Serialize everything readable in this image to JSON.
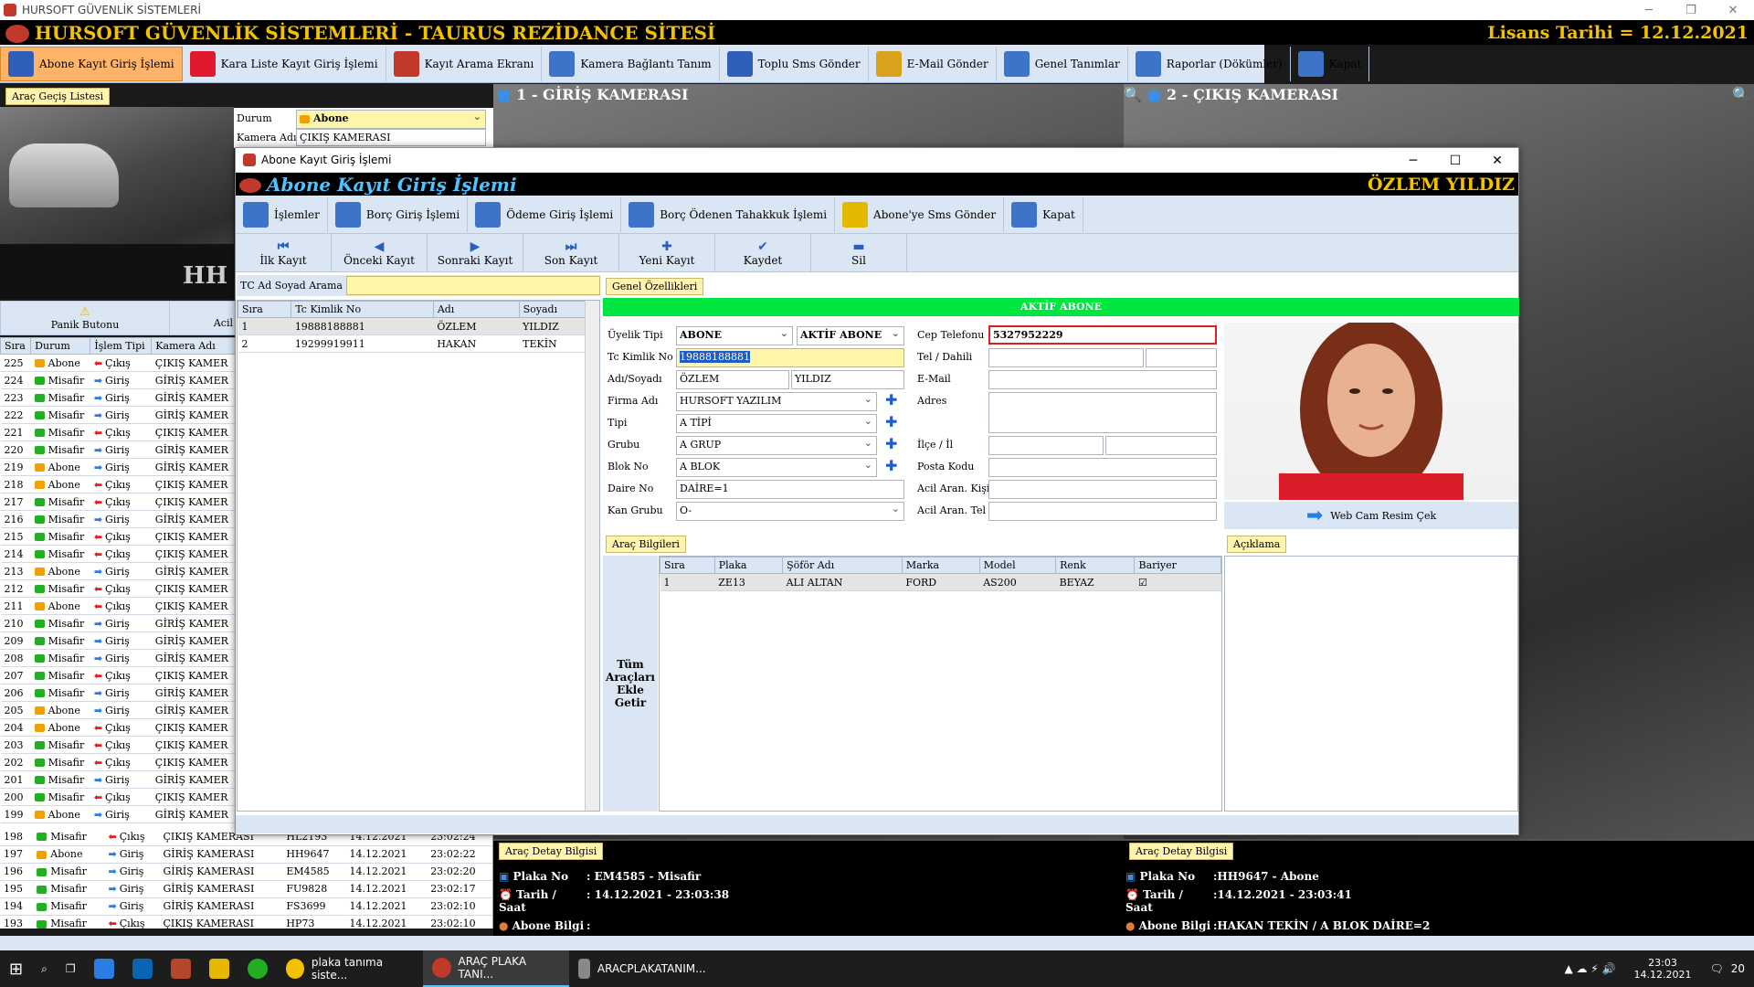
{
  "window": {
    "title": "HURSOFT GÜVENLİK SİSTEMLERİ"
  },
  "banner": {
    "title": "HURSOFT GÜVENLİK SİSTEMLERİ - TAURUS REZİDANCE SİTESİ",
    "license": "Lisans Tarihi = 12.12.2021"
  },
  "toolbar": {
    "items": [
      {
        "label": "Abone Kayıt Giriş İşlemi",
        "icon": "grid-icon",
        "color": "#2f5fb8"
      },
      {
        "label": "Kara Liste Kayıt Giriş İşlemi",
        "icon": "close-circle-icon",
        "color": "#e0192f"
      },
      {
        "label": "Kayıt Arama Ekranı",
        "icon": "search-tool-icon",
        "color": "#c0392b"
      },
      {
        "label": "Kamera Bağlantı Tanım",
        "icon": "document-arrow-icon",
        "color": "#3d74c9"
      },
      {
        "label": "Toplu Sms Gönder",
        "icon": "info-icon",
        "color": "#2f5fb8"
      },
      {
        "label": "E-Mail Gönder",
        "icon": "keyboard-icon",
        "color": "#d8a21c"
      },
      {
        "label": "Genel Tanımlar",
        "icon": "calendar-icon",
        "color": "#3d74c9"
      },
      {
        "label": "Raporlar (Dökümler)",
        "icon": "report-search-icon",
        "color": "#3d74c9"
      },
      {
        "label": "Kapat",
        "icon": "exit-icon",
        "color": "#3d74c9"
      }
    ]
  },
  "left": {
    "tab": "Araç Geçiş Listesi",
    "status_label": "Durum",
    "status_value": "Abone",
    "camera_label": "Kamera Adı",
    "camera_value": "ÇIKIŞ KAMERASI",
    "panic_label": "Panik Butonu",
    "acil_label": "Acil",
    "columns": [
      "Sıra",
      "Durum",
      "İşlem Tipi",
      "Kamera Adı"
    ],
    "rows": [
      {
        "no": "225",
        "status": "Abone",
        "type": "Çıkış",
        "camera": "ÇIKIŞ KAMER"
      },
      {
        "no": "224",
        "status": "Misafir",
        "type": "Giriş",
        "camera": "GİRİŞ KAMER"
      },
      {
        "no": "223",
        "status": "Misafir",
        "type": "Giriş",
        "camera": "GİRİŞ KAMER"
      },
      {
        "no": "222",
        "status": "Misafir",
        "type": "Giriş",
        "camera": "GİRİŞ KAMER"
      },
      {
        "no": "221",
        "status": "Misafir",
        "type": "Çıkış",
        "camera": "ÇIKIŞ KAMER"
      },
      {
        "no": "220",
        "status": "Misafir",
        "type": "Giriş",
        "camera": "GİRİŞ KAMER"
      },
      {
        "no": "219",
        "status": "Abone",
        "type": "Giriş",
        "camera": "GİRİŞ KAMER"
      },
      {
        "no": "218",
        "status": "Abone",
        "type": "Çıkış",
        "camera": "ÇIKIŞ KAMER"
      },
      {
        "no": "217",
        "status": "Misafir",
        "type": "Çıkış",
        "camera": "ÇIKIŞ KAMER"
      },
      {
        "no": "216",
        "status": "Misafir",
        "type": "Giriş",
        "camera": "GİRİŞ KAMER"
      },
      {
        "no": "215",
        "status": "Misafir",
        "type": "Çıkış",
        "camera": "ÇIKIŞ KAMER"
      },
      {
        "no": "214",
        "status": "Misafir",
        "type": "Çıkış",
        "camera": "ÇIKIŞ KAMER"
      },
      {
        "no": "213",
        "status": "Abone",
        "type": "Giriş",
        "camera": "GİRİŞ KAMER"
      },
      {
        "no": "212",
        "status": "Misafir",
        "type": "Çıkış",
        "camera": "ÇIKIŞ KAMER"
      },
      {
        "no": "211",
        "status": "Abone",
        "type": "Çıkış",
        "camera": "ÇIKIŞ KAMER"
      },
      {
        "no": "210",
        "status": "Misafir",
        "type": "Giriş",
        "camera": "GİRİŞ KAMER"
      },
      {
        "no": "209",
        "status": "Misafir",
        "type": "Giriş",
        "camera": "GİRİŞ KAMER"
      },
      {
        "no": "208",
        "status": "Misafir",
        "type": "Giriş",
        "camera": "GİRİŞ KAMER"
      },
      {
        "no": "207",
        "status": "Misafir",
        "type": "Çıkış",
        "camera": "ÇIKIŞ KAMER"
      },
      {
        "no": "206",
        "status": "Misafir",
        "type": "Giriş",
        "camera": "GİRİŞ KAMER"
      },
      {
        "no": "205",
        "status": "Abone",
        "type": "Giriş",
        "camera": "GİRİŞ KAMER"
      },
      {
        "no": "204",
        "status": "Abone",
        "type": "Çıkış",
        "camera": "ÇIKIŞ KAMER"
      },
      {
        "no": "203",
        "status": "Misafir",
        "type": "Çıkış",
        "camera": "ÇIKIŞ KAMER"
      },
      {
        "no": "202",
        "status": "Misafir",
        "type": "Çıkış",
        "camera": "ÇIKIŞ KAMER"
      },
      {
        "no": "201",
        "status": "Misafir",
        "type": "Giriş",
        "camera": "GİRİŞ KAMER"
      },
      {
        "no": "200",
        "status": "Misafir",
        "type": "Çıkış",
        "camera": "ÇIKIŞ KAMER"
      },
      {
        "no": "199",
        "status": "Abone",
        "type": "Giriş",
        "camera": "GİRİŞ KAMER"
      }
    ],
    "rows_full": [
      {
        "no": "198",
        "status": "Misafir",
        "type": "Çıkış",
        "camera": "ÇIKIŞ KAMERASI",
        "plate": "HL2193",
        "date": "14.12.2021",
        "time": "23:02:24"
      },
      {
        "no": "197",
        "status": "Abone",
        "type": "Giriş",
        "camera": "GİRİŞ KAMERASI",
        "plate": "HH9647",
        "date": "14.12.2021",
        "time": "23:02:22"
      },
      {
        "no": "196",
        "status": "Misafir",
        "type": "Giriş",
        "camera": "GİRİŞ KAMERASI",
        "plate": "EM4585",
        "date": "14.12.2021",
        "time": "23:02:20"
      },
      {
        "no": "195",
        "status": "Misafir",
        "type": "Giriş",
        "camera": "GİRİŞ KAMERASI",
        "plate": "FU9828",
        "date": "14.12.2021",
        "time": "23:02:17"
      },
      {
        "no": "194",
        "status": "Misafir",
        "type": "Giriş",
        "camera": "GİRİŞ KAMERASI",
        "plate": "FS3699",
        "date": "14.12.2021",
        "time": "23:02:10"
      },
      {
        "no": "193",
        "status": "Misafir",
        "type": "Çıkış",
        "camera": "ÇIKIŞ KAMERASI",
        "plate": "HP73",
        "date": "14.12.2021",
        "time": "23:02:10"
      }
    ]
  },
  "cameras": {
    "cam1": "1 - GİRİŞ KAMERASI",
    "cam2": "2 - ÇIKIŞ KAMERASI"
  },
  "details": {
    "tab": "Araç Detay Bilgisi",
    "plate_label": "Plaka No",
    "datetime_label": "Tarih / Saat",
    "owner_label": "Abone Bilgi",
    "left": {
      "plate": ": EM4585 - Misafir",
      "datetime": ": 14.12.2021 - 23:03:38",
      "owner": ":"
    },
    "right": {
      "plate": ":HH9647 - Abone",
      "datetime": ":14.12.2021 - 23:03:41",
      "owner": ":HAKAN TEKİN / A BLOK DAİRE=2"
    }
  },
  "dialog": {
    "title": "Abone Kayıt Giriş İşlemi",
    "banner_title": "Abone Kayıt Giriş İşlemi",
    "banner_name": "ÖZLEM YILDIZ",
    "tools": [
      {
        "label": "İşlemler",
        "icon": "operations-icon",
        "color": "#3d74c9"
      },
      {
        "label": "Borç Giriş İşlemi",
        "icon": "debt-entry-icon",
        "color": "#3d74c9"
      },
      {
        "label": "Ödeme Giriş İşlemi",
        "icon": "payment-icon",
        "color": "#3d74c9"
      },
      {
        "label": "Borç Ödenen Tahakkuk İşlemi",
        "icon": "accrual-icon",
        "color": "#3d74c9"
      },
      {
        "label": "Abone'ye Sms Gönder",
        "icon": "warning-icon",
        "color": "#e5b800"
      },
      {
        "label": "Kapat",
        "icon": "exit-icon",
        "color": "#3d74c9"
      }
    ],
    "nav": [
      {
        "label": "İlk Kayıt",
        "glyph": "⏮"
      },
      {
        "label": "Önceki Kayıt",
        "glyph": "◀"
      },
      {
        "label": "Sonraki Kayıt",
        "glyph": "▶"
      },
      {
        "label": "Son Kayıt",
        "glyph": "⏭"
      },
      {
        "label": "Yeni Kayıt",
        "glyph": "✚"
      },
      {
        "label": "Kaydet",
        "glyph": "✔"
      },
      {
        "label": "Sil",
        "glyph": "▬"
      }
    ],
    "search_label": "TC Ad Soyad Arama",
    "search_value": "",
    "list_columns": [
      "Sıra",
      "Tc Kimlik No",
      "Adı",
      "Soyadı"
    ],
    "list_rows": [
      {
        "no": "1",
        "tc": "19888188881",
        "name": "ÖZLEM",
        "surname": "YILDIZ"
      },
      {
        "no": "2",
        "tc": "19299919911",
        "name": "HAKAN",
        "surname": "TEKİN"
      }
    ],
    "general_tab": "Genel Özellikleri",
    "active_status": "AKTİF ABONE",
    "form": {
      "uyelik_label": "Üyelik Tipi",
      "uyelik_value": "ABONE",
      "uyelik_status": "AKTİF ABONE",
      "tc_label": "Tc Kimlik No",
      "tc_value": "19888188881",
      "adsoyad_label": "Adı/Soyadı",
      "ad_value": "ÖZLEM",
      "soyad_value": "YILDIZ",
      "firma_label": "Firma Adı",
      "firma_value": "HURSOFT YAZILIM",
      "tipi_label": "Tipi",
      "tipi_value": "A TİPİ",
      "grubu_label": "Grubu",
      "grubu_value": "A GRUP",
      "blok_label": "Blok No",
      "blok_value": "A BLOK",
      "daire_label": "Daire No",
      "daire_value": "DAİRE=1",
      "kan_label": "Kan Grubu",
      "kan_value": "O-",
      "cep_label": "Cep Telefonu",
      "cep_value": "5327952229",
      "tel_label": "Tel / Dahili",
      "tel_value": "",
      "dahili_value": "",
      "email_label": "E-Mail",
      "email_value": "",
      "adres_label": "Adres",
      "adres_value": "",
      "ilce_label": "İlçe / İl",
      "ilce_value": "",
      "il_value": "",
      "posta_label": "Posta Kodu",
      "posta_value": "",
      "acil_kisi_label": "Acil Aran. Kişi",
      "acil_kisi_value": "",
      "acil_tel_label": "Acil Aran. Tel",
      "acil_tel_value": ""
    },
    "webcam_label": "Web Cam Resim Çek",
    "vehicle_tab": "Araç Bilgileri",
    "add_all_label": "Tüm Araçları Ekle Getir",
    "vehicle_columns": [
      "Sıra",
      "Plaka",
      "Şöför Adı",
      "Marka",
      "Model",
      "Renk",
      "Bariyer"
    ],
    "vehicle_rows": [
      {
        "no": "1",
        "plate": "ZE13",
        "driver": "ALI ALTAN",
        "brand": "FORD",
        "model": "AS200",
        "color": "BEYAZ",
        "barrier": "☑"
      }
    ],
    "note_tab": "Açıklama"
  },
  "taskbar": {
    "items": [
      {
        "label": "plaka tanıma siste..."
      },
      {
        "label": "ARAÇ PLAKA TANI..."
      },
      {
        "label": "ARACPLAKATANIM..."
      }
    ],
    "time": "23:03",
    "date": "14.12.2021",
    "notif": "20"
  },
  "colors": {
    "abone": "#f0a000",
    "misafir": "#22b022",
    "giris": "#2a7de1",
    "cikis": "#e02020",
    "highlight": "#1f5cc7"
  }
}
